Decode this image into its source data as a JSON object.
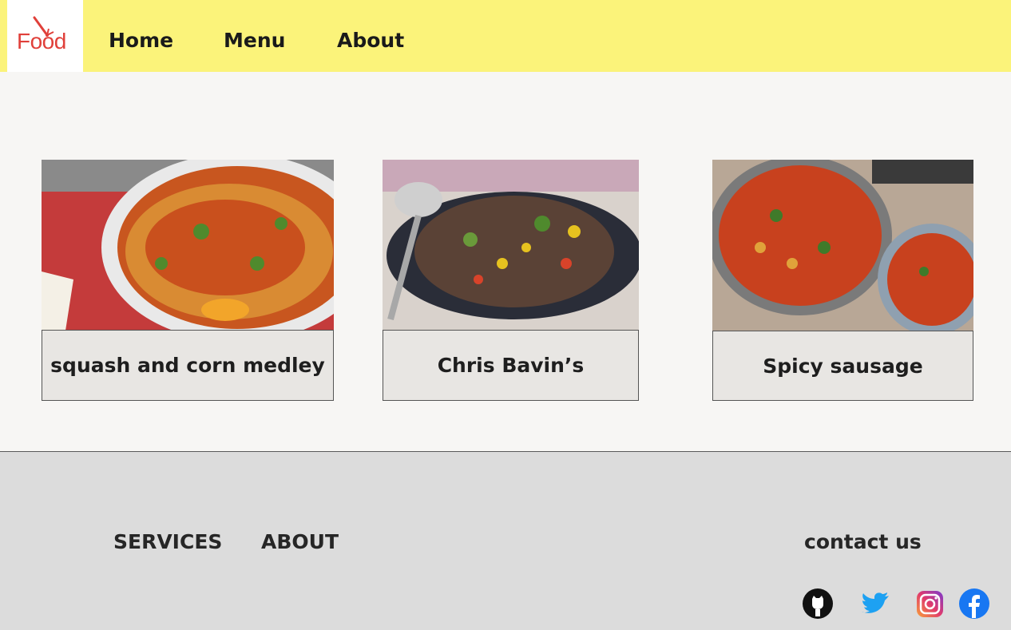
{
  "header": {
    "logo_text": "Food",
    "nav": [
      "Home",
      "Menu",
      "About"
    ]
  },
  "cards": [
    {
      "caption": "squash and corn medley",
      "image": "spaghetti-bolognese-photo"
    },
    {
      "caption": "Chris Bavin’s",
      "image": "grain-salad-photo"
    },
    {
      "caption": "Spicy sausage",
      "image": "sausage-pasta-photo"
    }
  ],
  "footer": {
    "links": [
      "SERVICES",
      "ABOUT"
    ],
    "contact": "contact us",
    "socials": [
      "github-icon",
      "twitter-icon",
      "instagram-icon",
      "facebook-icon"
    ]
  },
  "colors": {
    "header_bg": "#fbf37a",
    "logo_red": "#e0403a",
    "page_bg": "#f7f6f4",
    "footer_bg": "#dcdcdc",
    "caption_bg": "#e8e6e3"
  }
}
